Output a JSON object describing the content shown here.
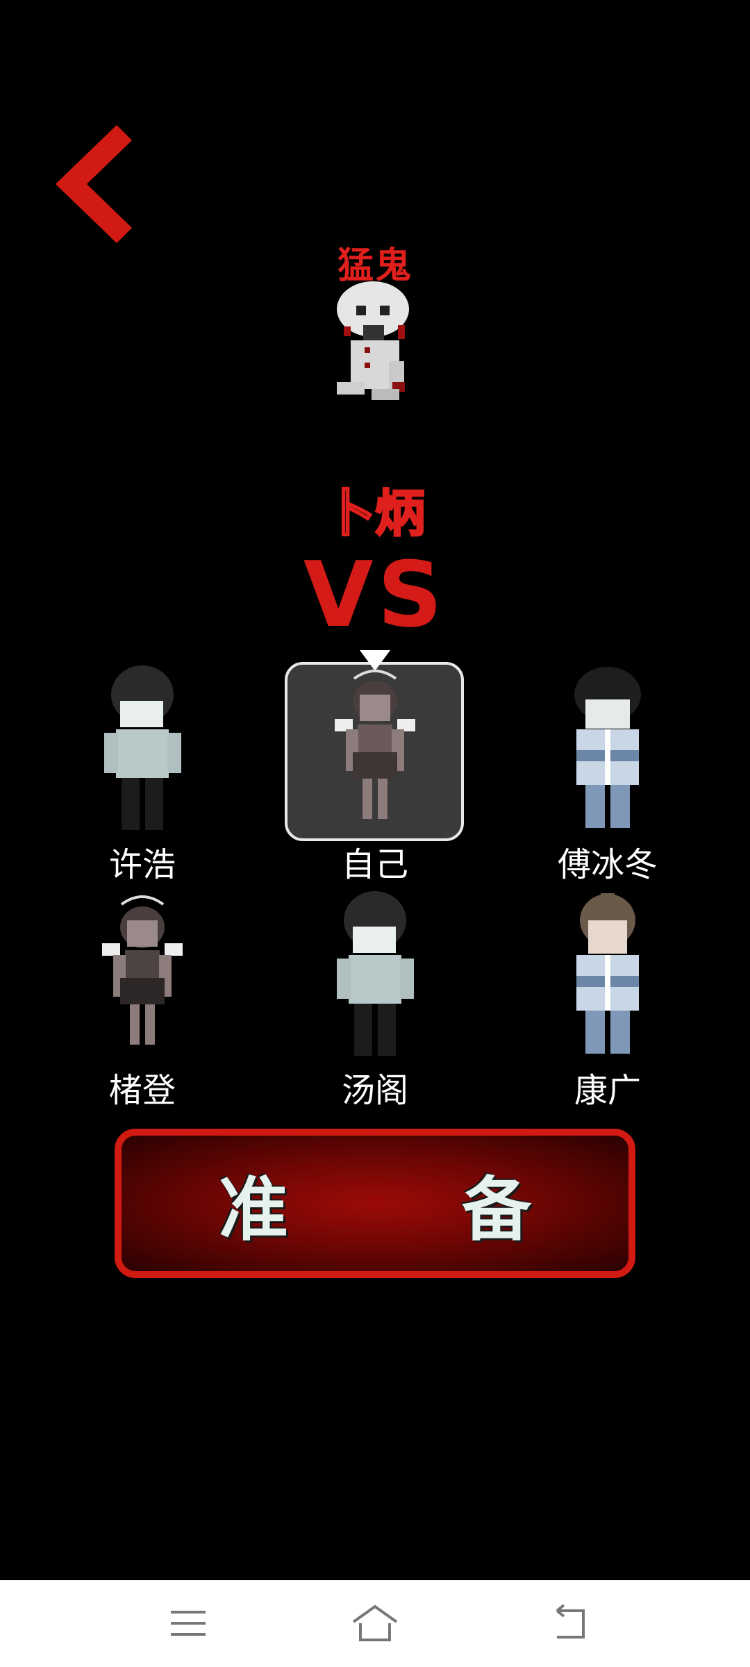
{
  "enemy": {
    "title": "猛鬼",
    "name": "卜炳"
  },
  "vs_label": "VS",
  "characters": [
    {
      "name": "许浩"
    },
    {
      "name": "自己"
    },
    {
      "name": "傅冰冬"
    },
    {
      "name": "楮登"
    },
    {
      "name": "汤阁"
    },
    {
      "name": "康广"
    }
  ],
  "selected_character": "自己",
  "ready_button": {
    "char1": "准",
    "char2": "备"
  },
  "colors": {
    "accent_red": "#d41b17",
    "background": "#000000",
    "label_white": "#ffffff"
  },
  "icons": {
    "back": "chevron-left-icon",
    "nav_menu": "menu-icon",
    "nav_home": "home-icon",
    "nav_back": "back-icon"
  }
}
